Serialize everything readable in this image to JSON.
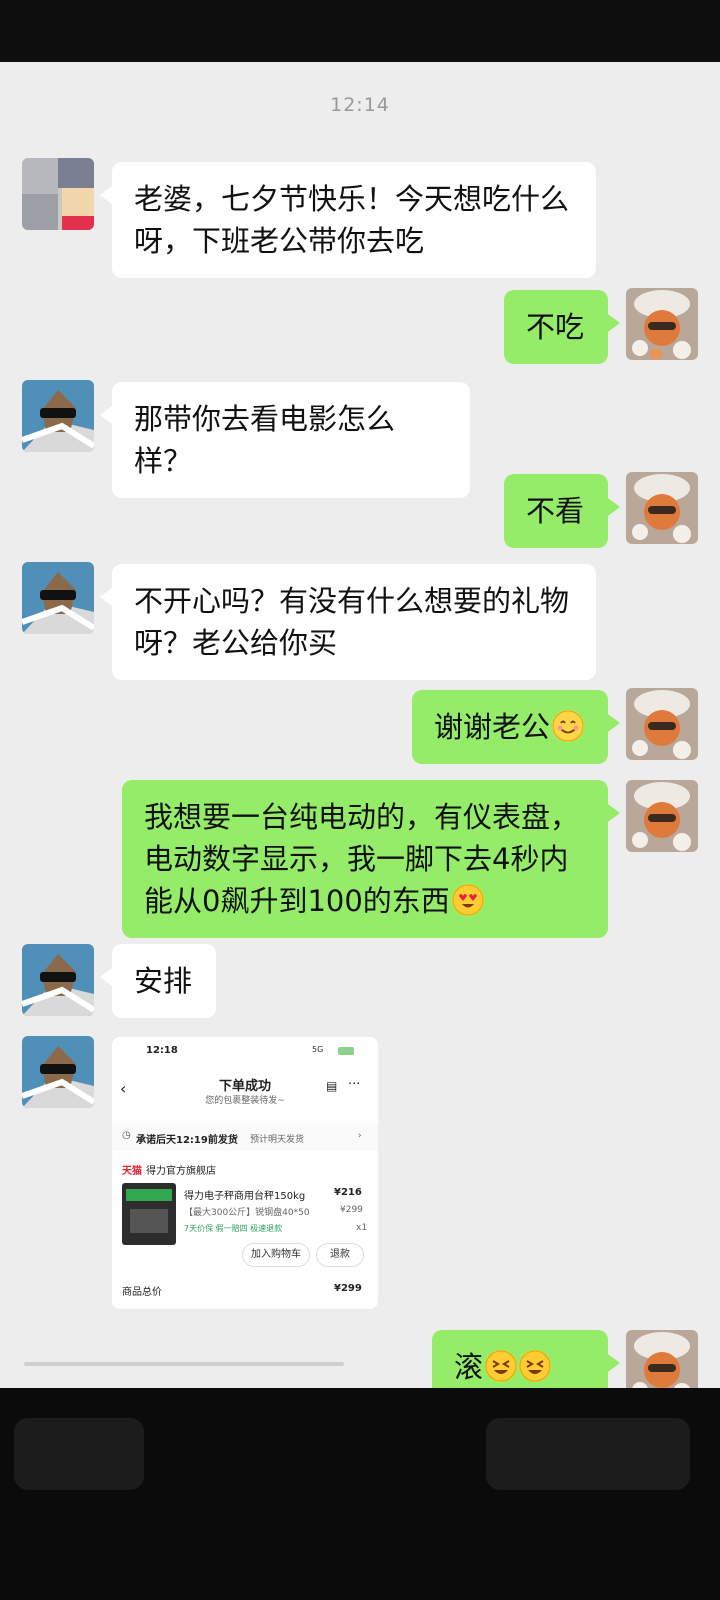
{
  "timestamp": "12:14",
  "messages": [
    {
      "side": "left",
      "avatar": "blurred-avatar",
      "text": "老婆，七夕节快乐！今天想吃什么呀，下班老公带你去吃"
    },
    {
      "side": "right",
      "avatar": "tan-hat-avatar",
      "text": "不吃"
    },
    {
      "side": "left",
      "avatar": "cat-sunglasses-avatar",
      "text": "那带你去看电影怎么样？"
    },
    {
      "side": "right",
      "avatar": "tan-hat-avatar",
      "text": "不看"
    },
    {
      "side": "left",
      "avatar": "cat-sunglasses-avatar",
      "text": "不开心吗？有没有什么想要的礼物呀？老公给你买"
    },
    {
      "side": "right",
      "avatar": "tan-hat-avatar",
      "text": "谢谢老公",
      "emoji": "smile-icon"
    },
    {
      "side": "right",
      "avatar": "tan-hat-avatar",
      "text": "我想要一台纯电动的，有仪表盘，电动数字显示，我一脚下去4秒内能从0飙升到100的东西",
      "emoji": "heart-eyes-icon"
    },
    {
      "side": "left",
      "avatar": "cat-sunglasses-avatar",
      "text": "安排"
    },
    {
      "side": "right",
      "avatar": "tan-hat-avatar",
      "text": "滚",
      "emoji": "laughing-icon"
    }
  ],
  "order_screenshot": {
    "status_time": "12:18",
    "status_signal": "5G",
    "title": "下单成功",
    "subtitle": "您的包裹整装待发~",
    "ship_promise": "承诺后天12:19前发货",
    "ship_note": "预计明天发货",
    "store_badge": "天猫",
    "store_name": "得力官方旗舰店",
    "product_name": "得力电子秤商用台秤150kg",
    "price_paid": "¥216",
    "spec": "【最大300公斤】锐钢盘40*50",
    "orig_price": "¥299",
    "service": "7天价保  假一赔四  极速退款",
    "qty": "x1",
    "btn_cart": "加入购物车",
    "btn_refund": "退款",
    "total_label": "商品总价",
    "total_value": "¥299"
  },
  "colors": {
    "outgoing_bubble": "#95ec69",
    "incoming_bubble": "#ffffff",
    "chat_bg": "#ededed"
  }
}
